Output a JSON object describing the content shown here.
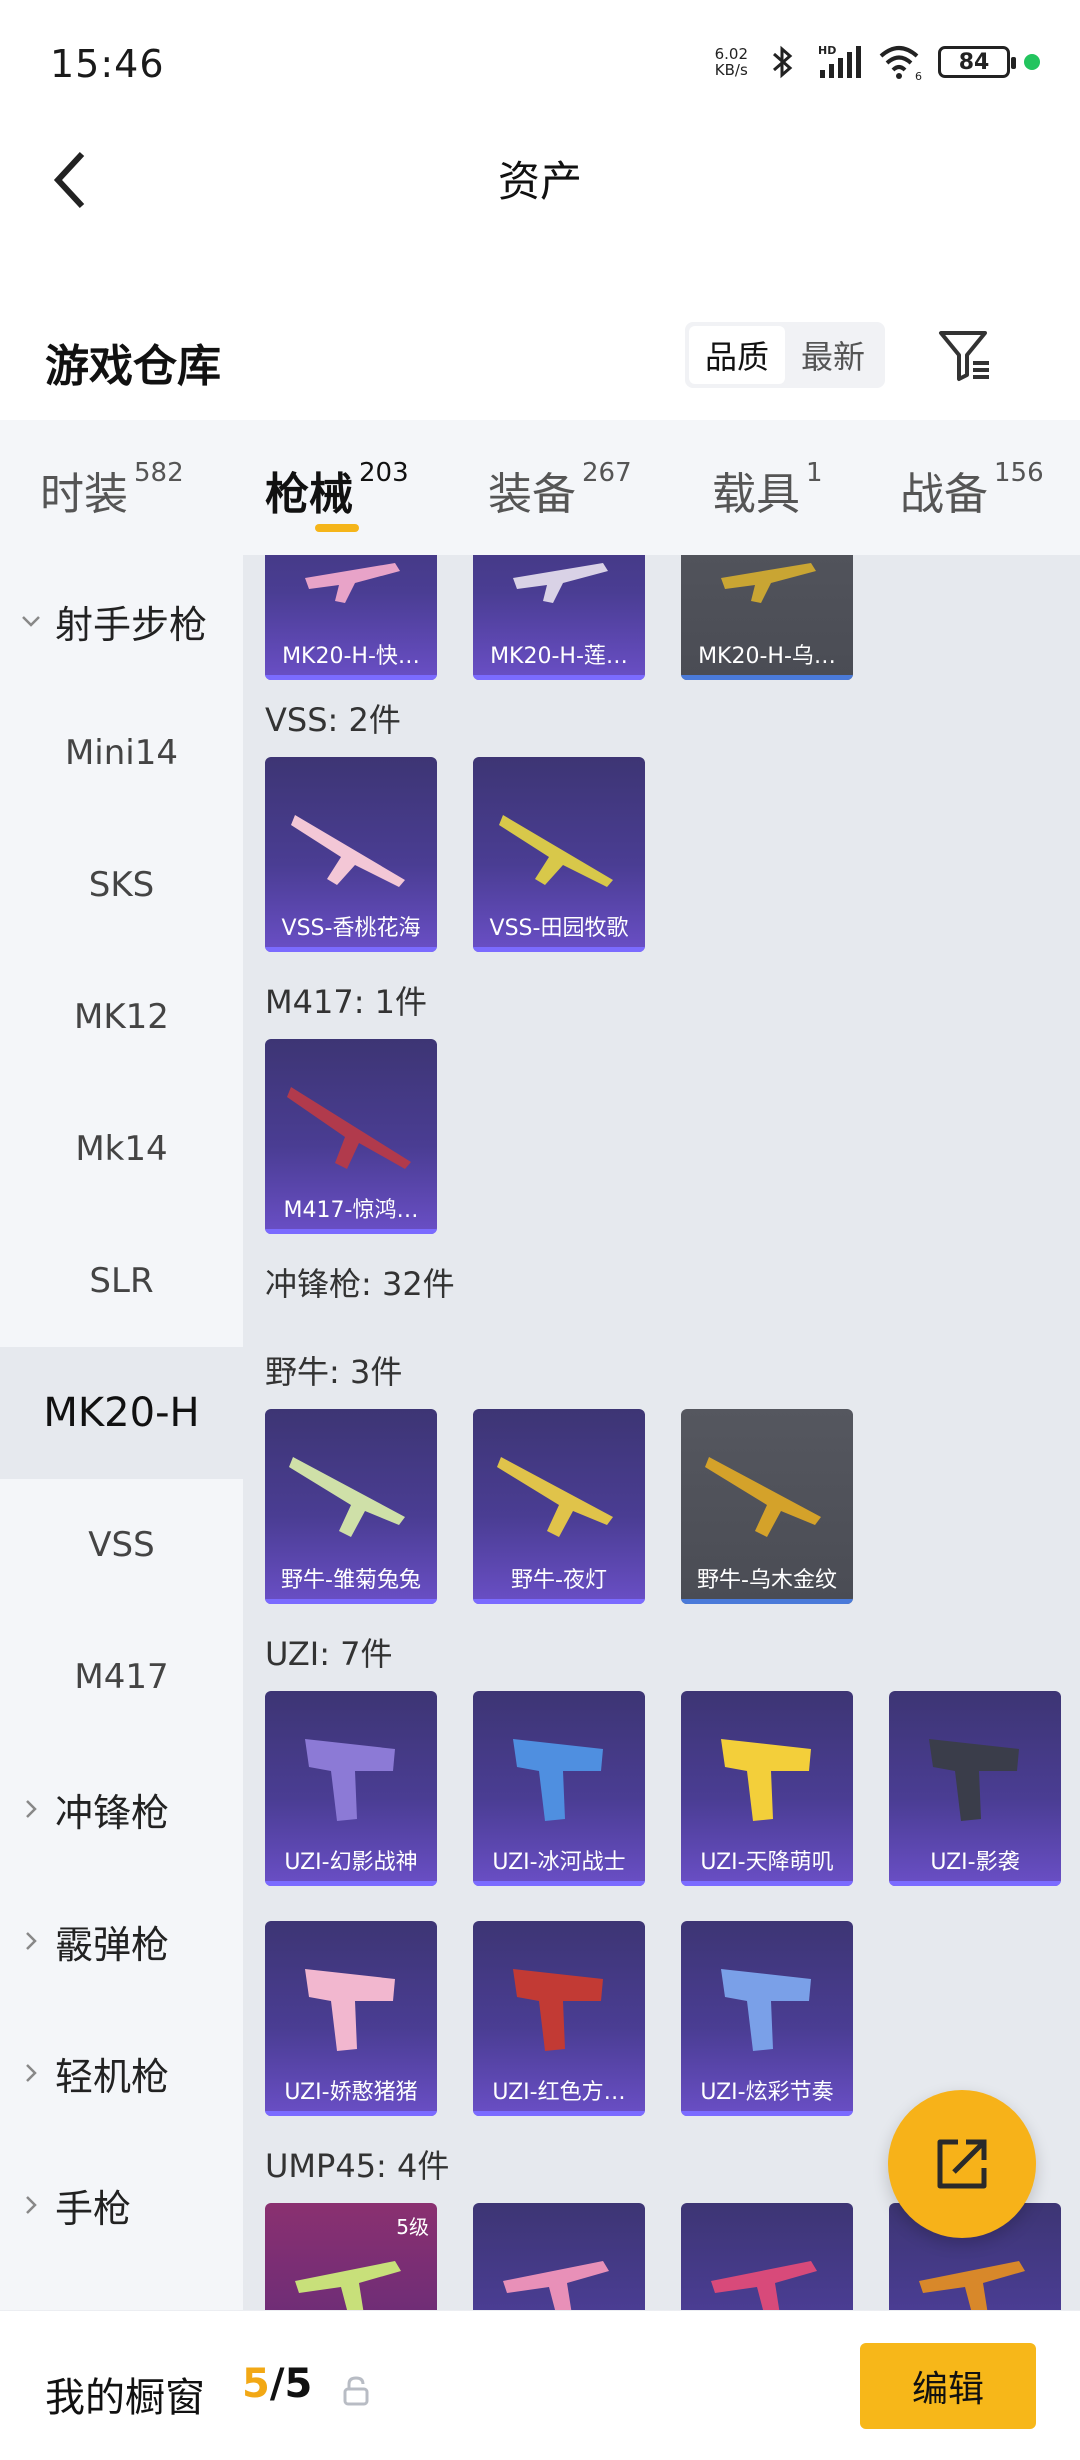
{
  "status_bar": {
    "time": "15:46",
    "net_speed_value": "6.02",
    "net_speed_unit": "KB/s",
    "signal_label": "HD",
    "wifi_label": "6",
    "battery": "84"
  },
  "header": {
    "title": "资产"
  },
  "warehouse": {
    "title": "游戏仓库",
    "sort_options": [
      "品质",
      "最新"
    ],
    "sort_active": "品质"
  },
  "tabs": [
    {
      "label": "时装",
      "count": "582"
    },
    {
      "label": "枪械",
      "count": "203"
    },
    {
      "label": "装备",
      "count": "267"
    },
    {
      "label": "载具",
      "count": "1"
    },
    {
      "label": "战备",
      "count": "156"
    }
  ],
  "active_tab": "枪械",
  "sidebar": {
    "items": [
      {
        "label": "射手步枪",
        "type": "group",
        "expanded": true
      },
      {
        "label": "Mini14",
        "type": "sub"
      },
      {
        "label": "SKS",
        "type": "sub"
      },
      {
        "label": "MK12",
        "type": "sub"
      },
      {
        "label": "Mk14",
        "type": "sub"
      },
      {
        "label": "SLR",
        "type": "sub"
      },
      {
        "label": "MK20-H",
        "type": "sub",
        "selected": true
      },
      {
        "label": "VSS",
        "type": "sub"
      },
      {
        "label": "M417",
        "type": "sub"
      },
      {
        "label": "冲锋枪",
        "type": "group",
        "expanded": false
      },
      {
        "label": "霰弹枪",
        "type": "group",
        "expanded": false
      },
      {
        "label": "轻机枪",
        "type": "group",
        "expanded": false
      },
      {
        "label": "手枪",
        "type": "group",
        "expanded": false
      }
    ]
  },
  "content": {
    "mk20_cards": [
      "MK20-H-快…",
      "MK20-H-莲…",
      "MK20-H-乌…"
    ],
    "vss": {
      "label": "VSS: 2件",
      "cards": [
        "VSS-香桃花海",
        "VSS-田园牧歌"
      ]
    },
    "m417": {
      "label": "M417: 1件",
      "cards": [
        "M417-惊鸿…"
      ]
    },
    "smg_label": "冲锋枪: 32件",
    "bison": {
      "label": "野牛: 3件",
      "cards": [
        "野牛-雏菊兔兔",
        "野牛-夜灯",
        "野牛-乌木金纹"
      ]
    },
    "uzi": {
      "label": "UZI: 7件",
      "cards": [
        "UZI-幻影战神",
        "UZI-冰河战士",
        "UZI-天降萌叽",
        "UZI-影袭",
        "UZI-娇憨猪猪",
        "UZI-红色方…",
        "UZI-炫彩节奏"
      ]
    },
    "ump": {
      "label": "UMP45: 4件",
      "level_badge": "5级"
    }
  },
  "bottom_bar": {
    "label": "我的橱窗",
    "count_current": "5",
    "count_separator": "/",
    "count_total": "5",
    "edit_label": "编辑"
  },
  "colors": {
    "accent": "#f7b719",
    "card_purple": "#4a3d93",
    "card_gray": "#4a4c54",
    "content_bg": "#e6e9ee",
    "sidebar_bg": "#f4f6f9"
  }
}
